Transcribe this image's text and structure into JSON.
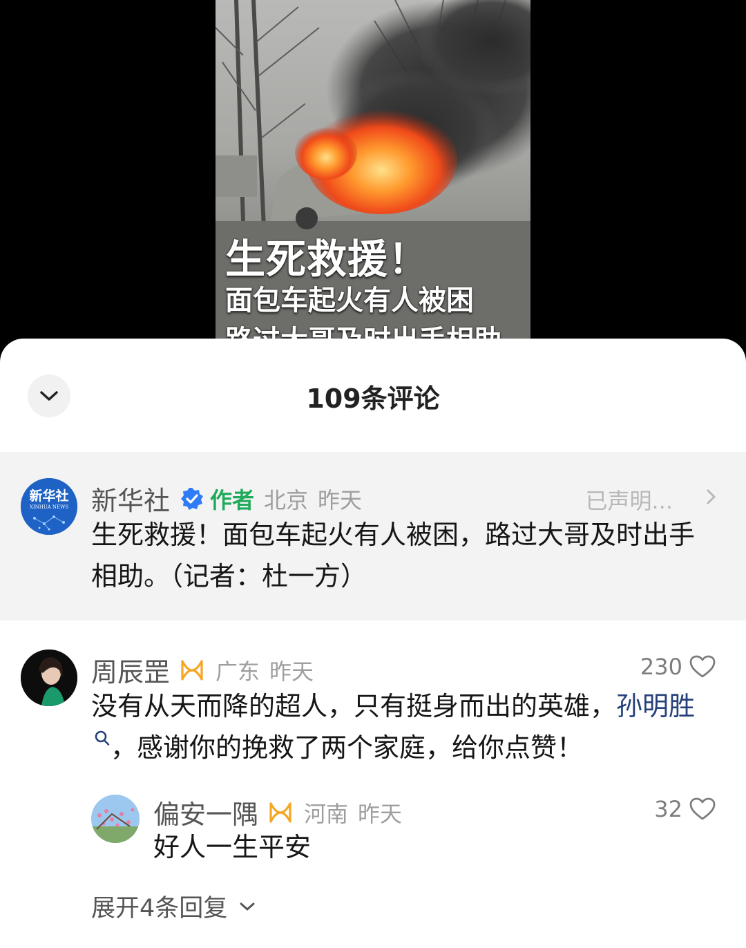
{
  "video": {
    "caption_title": "生死救援！",
    "caption_line1": "面包车起火有人被困",
    "caption_line2": "路过大哥及时出手相助"
  },
  "sheet": {
    "title": "109条评论"
  },
  "author_post": {
    "username": "新华社",
    "author_tag": "作者",
    "location": "北京",
    "time": "昨天",
    "declared": "已声明...",
    "avatar_text_cn": "新华社",
    "avatar_text_en": "XINHUA NEWS",
    "text": "生死救援！面包车起火有人被困，路过大哥及时出手相助。（记者：杜一方）"
  },
  "comments": [
    {
      "username": "周辰罡",
      "location": "广东",
      "time": "昨天",
      "likes": "230",
      "text_before": "没有从天而降的超人，只有挺身而出的英雄，",
      "link_text": "孙明胜",
      "text_after": "，感谢你的挽救了两个家庭，给你点赞！"
    },
    {
      "username": "偏安一隅",
      "location": "河南",
      "time": "昨天",
      "likes": "32",
      "text": "好人一生平安"
    }
  ],
  "expand_replies": "展开4条回复",
  "colors": {
    "author_green": "#1fab5b",
    "verified_blue": "#2f7cf6",
    "vip_orange": "#f5a623",
    "link_blue": "#25407a"
  },
  "icons": [
    "chevron-down-icon",
    "verified-icon",
    "chevron-right-icon",
    "vip-icon",
    "search-icon",
    "heart-icon"
  ]
}
